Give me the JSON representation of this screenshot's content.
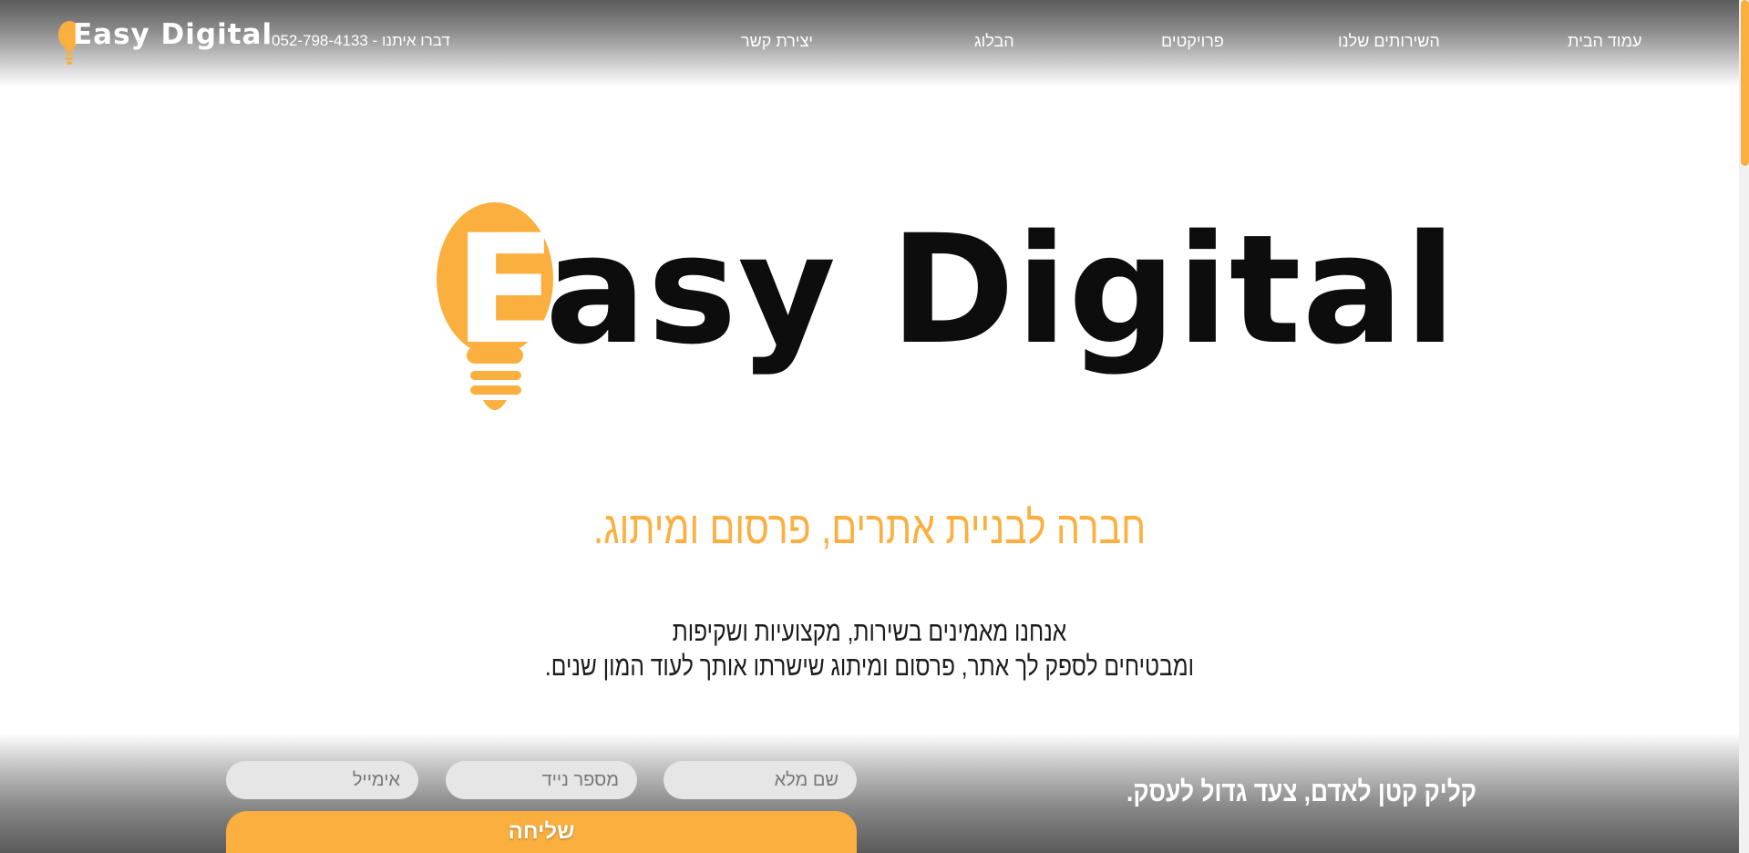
{
  "header": {
    "logo_text": "Easy Digital",
    "phone_text": "דברו איתנו - 052-798-4133",
    "nav": [
      {
        "id": "home",
        "label": "עמוד הבית"
      },
      {
        "id": "services",
        "label": "השירותים שלנו"
      },
      {
        "id": "projects",
        "label": "פרויקטים"
      },
      {
        "id": "blog",
        "label": "הבלוג"
      },
      {
        "id": "contact",
        "label": "יצירת קשר"
      }
    ]
  },
  "hero": {
    "logo_text": "asy Digital",
    "logo_letter": "E",
    "tagline": "חברה לבניית אתרים, פרסום ומיתוג.",
    "description_line1": "אנחנו מאמינים בשירות, מקצועיות ושקיפות",
    "description_line2": "ומבטיחים לספק לך אתר, פרסום ומיתוג שישרתו אותך לעוד המון שנים."
  },
  "contact_bar": {
    "slogan": "קליק קטן לאדם, צעד גדול לעסק.",
    "name_placeholder": "שם מלא",
    "phone_placeholder": "מספר נייד",
    "email_placeholder": "אימייל",
    "send_label": "שליחה"
  },
  "colors": {
    "accent": "#fbaf3f",
    "header_dark": "#5c5c5c",
    "text_dark": "#0d0d0d"
  },
  "icons": {
    "logo_icon": "lightbulb-icon"
  }
}
